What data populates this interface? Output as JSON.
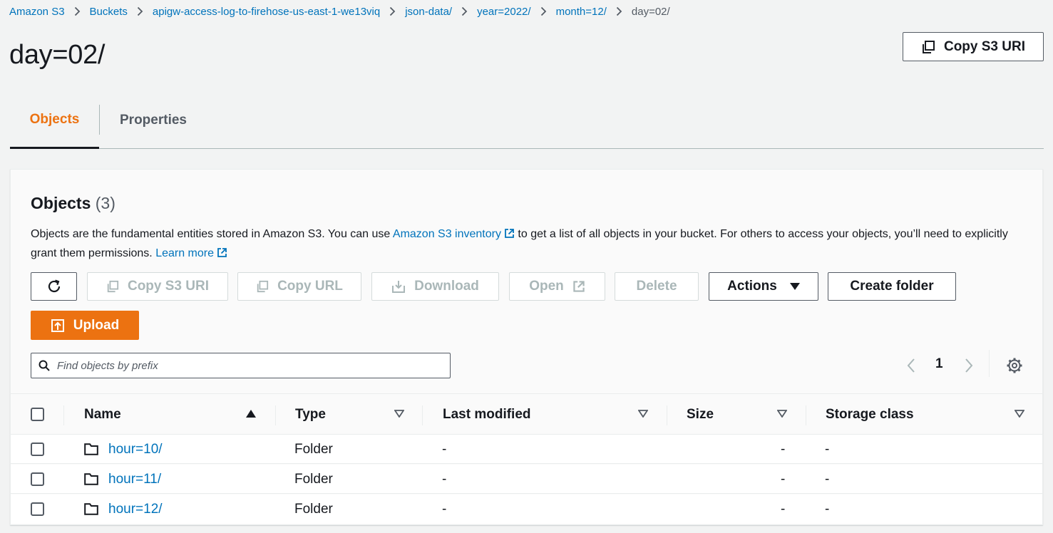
{
  "breadcrumbs": [
    {
      "label": "Amazon S3"
    },
    {
      "label": "Buckets"
    },
    {
      "label": "apigw-access-log-to-firehose-us-east-1-we13viq"
    },
    {
      "label": "json-data/"
    },
    {
      "label": "year=2022/"
    },
    {
      "label": "month=12/"
    },
    {
      "label": "day=02/"
    }
  ],
  "page_title": "day=02/",
  "header": {
    "copy_s3_uri_label": "Copy S3 URI"
  },
  "tabs": [
    {
      "label": "Objects",
      "active": true
    },
    {
      "label": "Properties",
      "active": false
    }
  ],
  "objects_panel": {
    "title": "Objects",
    "count": "(3)",
    "description_part1": "Objects are the fundamental entities stored in Amazon S3. You can use ",
    "inventory_link": "Amazon S3 inventory",
    "description_part2": " to get a list of all objects in your bucket. For others to access your objects, you’ll need to explicitly grant them permissions. ",
    "learn_more_link": "Learn more"
  },
  "toolbar": {
    "refresh_icon": "refresh-icon",
    "copy_s3_uri": "Copy S3 URI",
    "copy_url": "Copy URL",
    "download": "Download",
    "open": "Open",
    "delete": "Delete",
    "actions": "Actions",
    "create_folder": "Create folder",
    "upload": "Upload"
  },
  "search": {
    "placeholder": "Find objects by prefix",
    "value": ""
  },
  "pagination": {
    "current_page": "1"
  },
  "table": {
    "columns": {
      "name": "Name",
      "type": "Type",
      "last_modified": "Last modified",
      "size": "Size",
      "storage_class": "Storage class"
    },
    "rows": [
      {
        "name": "hour=10/",
        "type": "Folder",
        "last_modified": "-",
        "size": "-",
        "storage_class": "-"
      },
      {
        "name": "hour=11/",
        "type": "Folder",
        "last_modified": "-",
        "size": "-",
        "storage_class": "-"
      },
      {
        "name": "hour=12/",
        "type": "Folder",
        "last_modified": "-",
        "size": "-",
        "storage_class": "-"
      }
    ]
  },
  "colors": {
    "link": "#0073bb",
    "primary": "#ec7211",
    "text": "#16191f",
    "muted": "#545b64",
    "disabled": "#aab7b8"
  }
}
